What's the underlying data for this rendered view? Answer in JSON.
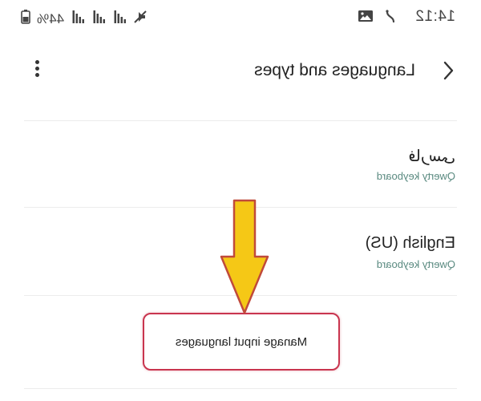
{
  "status_bar": {
    "time": "14:12",
    "battery_percent": "44%",
    "icons": [
      "nfc-icon",
      "image-icon",
      "signal-icon",
      "signal-icon",
      "signal-icon",
      "mute-icon",
      "battery-icon"
    ]
  },
  "app_bar": {
    "title": "Languages and types",
    "back_icon": "chevron-left-icon",
    "more_icon": "more-vert-icon"
  },
  "languages": [
    {
      "name": "فارسی",
      "keyboard": "Qwerty keyboard"
    },
    {
      "name": "English (US)",
      "keyboard": "Qwerty keyboard"
    }
  ],
  "manage_button": {
    "label": "Manage input languages"
  },
  "colors": {
    "button_border": "#c9354f",
    "subtitle": "#5a8a80",
    "arrow_fill": "#f5c816",
    "arrow_stroke": "#c04a3a"
  }
}
